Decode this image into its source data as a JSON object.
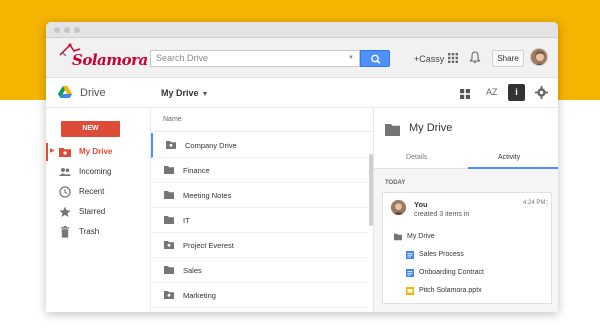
{
  "brand": {
    "logo_text": "Solamora"
  },
  "search": {
    "placeholder": "Search Drive"
  },
  "header": {
    "user_link": "+Cassy",
    "share_label": "Share"
  },
  "drivebar": {
    "app_title": "Drive",
    "location": "My Drive",
    "sort_icon_text": "AZ",
    "info_icon_text": "i"
  },
  "sidebar": {
    "new_label": "NEW",
    "items": [
      {
        "label": "My Drive",
        "icon": "drive-folder-icon",
        "active": true
      },
      {
        "label": "Incoming",
        "icon": "people-icon"
      },
      {
        "label": "Recent",
        "icon": "clock-icon"
      },
      {
        "label": "Starred",
        "icon": "star-icon"
      },
      {
        "label": "Trash",
        "icon": "trash-icon"
      }
    ]
  },
  "filelist": {
    "column_name": "Name",
    "files": [
      {
        "name": "Company Drive",
        "icon": "shared-folder-icon",
        "selected": true
      },
      {
        "name": "Finance",
        "icon": "folder-icon"
      },
      {
        "name": "Meeting Notes",
        "icon": "folder-icon"
      },
      {
        "name": "IT",
        "icon": "folder-icon"
      },
      {
        "name": "Project Everest",
        "icon": "shared-folder-icon"
      },
      {
        "name": "Sales",
        "icon": "folder-icon"
      },
      {
        "name": "Marketing",
        "icon": "shared-folder-icon"
      }
    ]
  },
  "details": {
    "title": "My Drive",
    "tabs": [
      {
        "label": "Details"
      },
      {
        "label": "Activity",
        "active": true
      }
    ],
    "section": "TODAY",
    "activity": {
      "user": "You",
      "action": "created 3 items in",
      "time": "4:24 PM",
      "folder": "My Drive",
      "items": [
        {
          "name": "Sales Process",
          "icon": "doc-icon",
          "color": "#4285f4"
        },
        {
          "name": "Onboarding Contract",
          "icon": "doc-icon",
          "color": "#4285f4"
        },
        {
          "name": "Pitch Solamora.pptx",
          "icon": "slides-icon",
          "color": "#f4b400"
        }
      ]
    }
  },
  "colors": {
    "accent": "#dd4b39",
    "blue": "#4d90fe",
    "background": "#f5b400"
  }
}
